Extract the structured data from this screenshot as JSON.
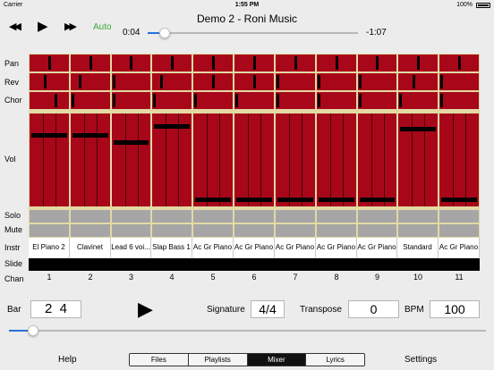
{
  "status": {
    "carrier": "Carrier",
    "time": "1:55 PM",
    "battery": "100%"
  },
  "transport": {
    "rewind": "◀◀",
    "play": "▶",
    "forward": "▶▶",
    "auto": "Auto",
    "title": "Demo 2 - Roni Music",
    "time_current": "0:04",
    "time_remaining": "-1:07",
    "progress": 0.06
  },
  "row_labels": {
    "pan": "Pan",
    "rev": "Rev",
    "chor": "Chor",
    "vol": "Vol",
    "solo": "Solo",
    "mute": "Mute",
    "instr": "Instr",
    "slide": "Slide",
    "chan": "Chan"
  },
  "channels": [
    {
      "chan": "1",
      "instr": "El Piano 2",
      "pan": 0.5,
      "rev": 0.4,
      "chor": 0.68,
      "vol": 0.78
    },
    {
      "chan": "2",
      "instr": "Clavinet",
      "pan": 0.5,
      "rev": 0.22,
      "chor": 0.02,
      "vol": 0.78
    },
    {
      "chan": "3",
      "instr": "Lead 6 voi...",
      "pan": 0.5,
      "rev": 0.02,
      "chor": 0.02,
      "vol": 0.69
    },
    {
      "chan": "4",
      "instr": "Slap Bass 1",
      "pan": 0.5,
      "rev": 0.22,
      "chor": 0.02,
      "vol": 0.88
    },
    {
      "chan": "5",
      "instr": "Ac Gr Piano",
      "pan": 0.5,
      "rev": 0.5,
      "chor": 0.02,
      "vol": 0.04
    },
    {
      "chan": "6",
      "instr": "Ac Gr Piano",
      "pan": 0.5,
      "rev": 0.5,
      "chor": 0.02,
      "vol": 0.04
    },
    {
      "chan": "7",
      "instr": "Ac Gr Piano",
      "pan": 0.5,
      "rev": 0.02,
      "chor": 0.02,
      "vol": 0.04
    },
    {
      "chan": "8",
      "instr": "Ac Gr Piano",
      "pan": 0.5,
      "rev": 0.02,
      "chor": 0.02,
      "vol": 0.04
    },
    {
      "chan": "9",
      "instr": "Ac Gr Piano",
      "pan": 0.5,
      "rev": 0.02,
      "chor": 0.02,
      "vol": 0.04
    },
    {
      "chan": "10",
      "instr": "Standard",
      "pan": 0.5,
      "rev": 0.4,
      "chor": 0.02,
      "vol": 0.85
    },
    {
      "chan": "11",
      "instr": "Ac Gr Piano",
      "pan": 0.5,
      "rev": 0.02,
      "chor": 0.02,
      "vol": 0.04
    }
  ],
  "bottom": {
    "bar_label": "Bar",
    "bar_value": "2  4",
    "play": "▶",
    "signature_label": "Signature",
    "signature_value": "4/4",
    "transpose_label": "Transpose",
    "transpose_value": "0",
    "bpm_label": "BPM",
    "bpm_value": "100",
    "bar_slider": 0.04
  },
  "footer": {
    "help": "Help",
    "settings": "Settings",
    "tabs": [
      {
        "label": "Files",
        "active": false
      },
      {
        "label": "Playlists",
        "active": false
      },
      {
        "label": "Mixer",
        "active": true
      },
      {
        "label": "Lyrics",
        "active": false
      }
    ]
  },
  "colors": {
    "fader": "#a8071a",
    "divider": "#e3d9a5",
    "toggle": "#a6a6a6",
    "accent": "#2a6fdb",
    "auto": "#3aa83a"
  }
}
